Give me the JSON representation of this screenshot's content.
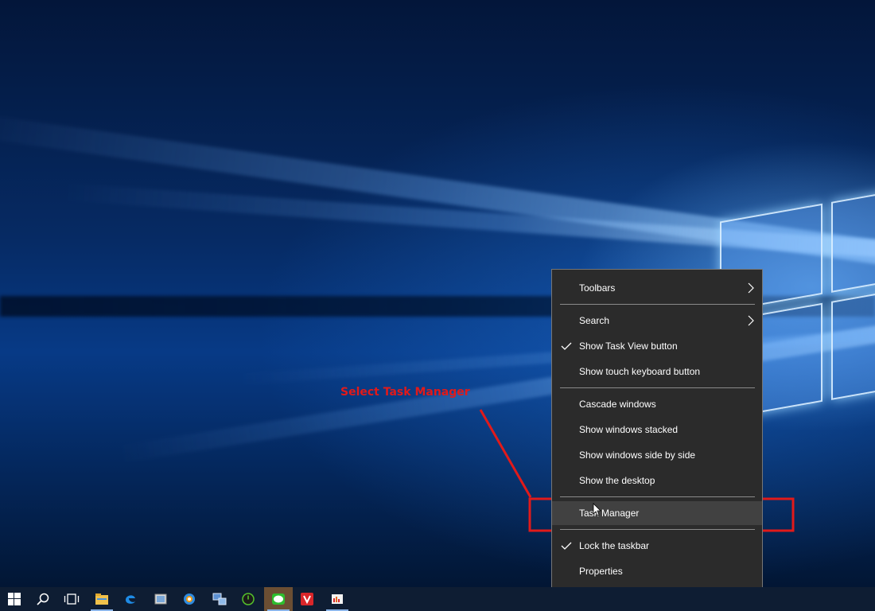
{
  "annotation": {
    "text": "Select Task Manager",
    "color": "#e11a1a"
  },
  "context_menu": {
    "items": [
      {
        "label": "Toolbars",
        "submenu": true,
        "checked": false
      },
      {
        "label": "Search",
        "submenu": true,
        "checked": false
      },
      {
        "label": "Show Task View button",
        "submenu": false,
        "checked": true
      },
      {
        "label": "Show touch keyboard button",
        "submenu": false,
        "checked": false
      },
      {
        "label": "Cascade windows",
        "submenu": false,
        "checked": false
      },
      {
        "label": "Show windows stacked",
        "submenu": false,
        "checked": false
      },
      {
        "label": "Show windows side by side",
        "submenu": false,
        "checked": false
      },
      {
        "label": "Show the desktop",
        "submenu": false,
        "checked": false
      },
      {
        "label": "Task Manager",
        "submenu": false,
        "checked": false,
        "highlighted": true
      },
      {
        "label": "Lock the taskbar",
        "submenu": false,
        "checked": true
      },
      {
        "label": "Properties",
        "submenu": false,
        "checked": false
      }
    ],
    "background": "#2b2b2b",
    "highlight": "#414141"
  },
  "taskbar": {
    "icons": [
      "windows-start-icon",
      "search-icon",
      "task-view-icon",
      "file-explorer-icon",
      "edge-browser-icon",
      "image-viewer-icon",
      "browser-app-icon",
      "network-app-icon",
      "power-app-icon",
      "line-chat-icon",
      "vivaldi-browser-icon",
      "office-app-icon"
    ]
  }
}
